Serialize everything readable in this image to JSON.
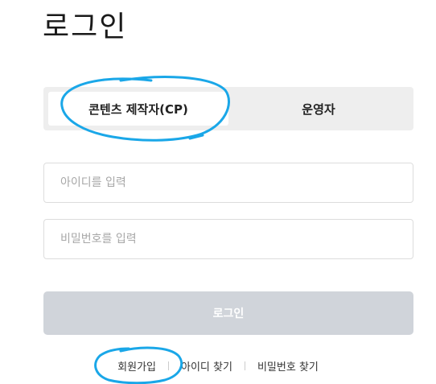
{
  "title": "로그인",
  "tabs": [
    {
      "label": "콘텐츠 제작자(CP)",
      "active": true
    },
    {
      "label": "운영자",
      "active": false
    }
  ],
  "fields": {
    "id_placeholder": "아이디를 입력",
    "password_placeholder": "비밀번호를 입력"
  },
  "login_button": "로그인",
  "links": {
    "signup": "회원가입",
    "find_id": "아이디 찾기",
    "find_password": "비밀번호 찾기"
  },
  "colors": {
    "annotation": "#1aa7e8",
    "login_button_bg": "#d0d4da",
    "tab_bg": "#eeeeee"
  }
}
